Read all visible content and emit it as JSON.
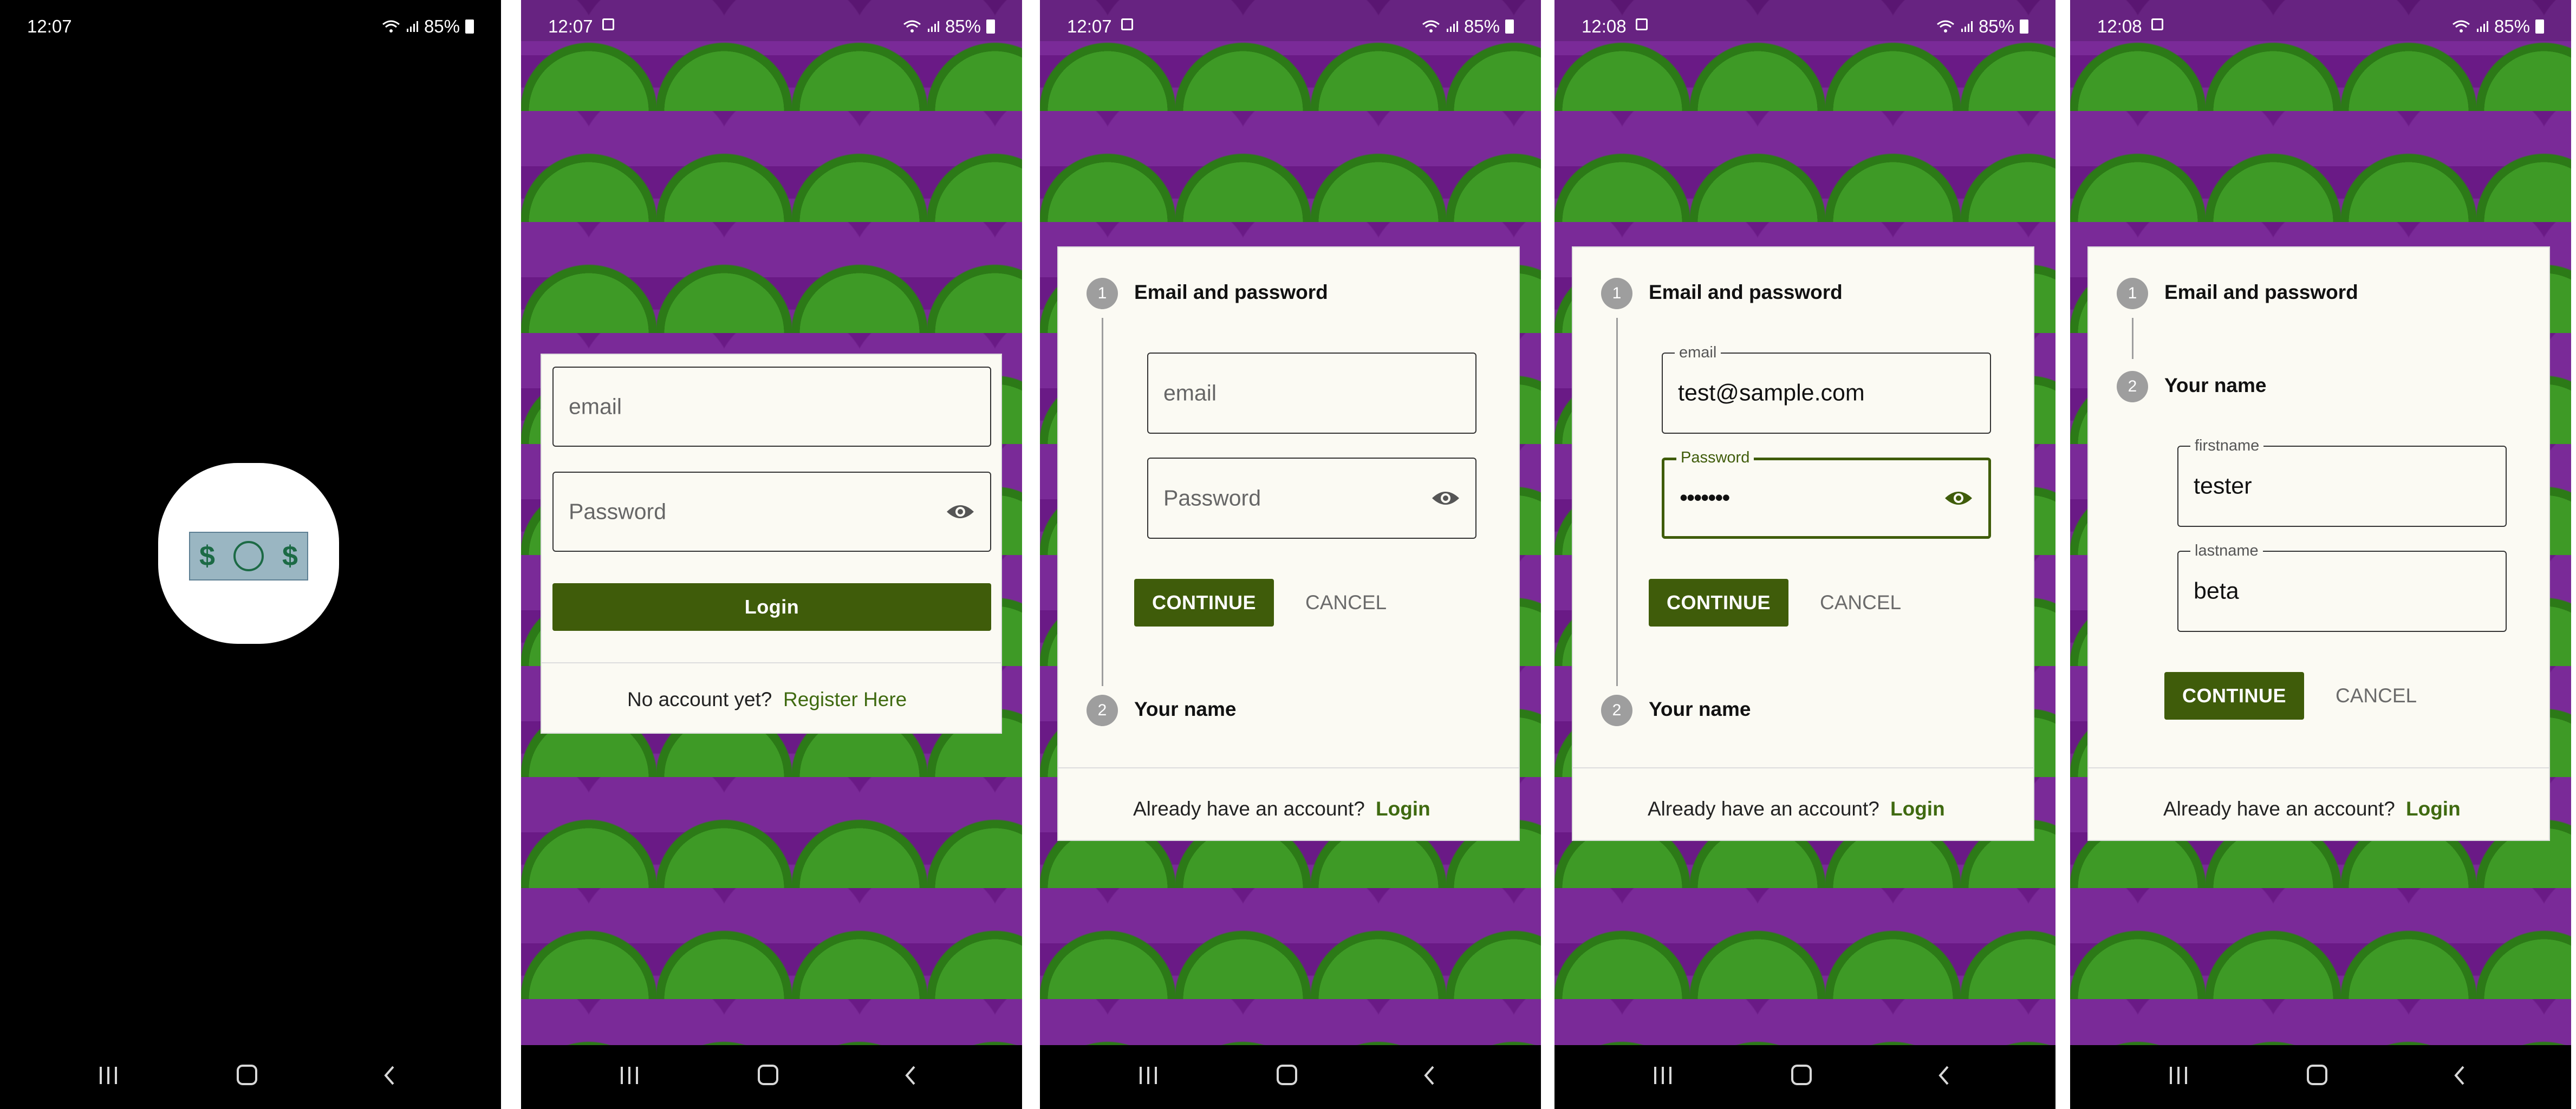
{
  "status": {
    "times": [
      "12:07",
      "12:07",
      "12:07",
      "12:08",
      "12:08"
    ],
    "battery": "85%"
  },
  "login": {
    "email_placeholder": "email",
    "password_placeholder": "Password",
    "login_button": "Login",
    "no_account": "No account yet?",
    "register_link": "Register Here"
  },
  "register": {
    "step1_number": "1",
    "step1_title": "Email and password",
    "step2_number": "2",
    "step2_title": "Your name",
    "email_placeholder": "email",
    "password_placeholder": "Password",
    "email_label": "email",
    "email_value": "test@sample.com",
    "password_label": "Password",
    "password_value": "•••••••",
    "firstname_label": "firstname",
    "firstname_value": "tester",
    "lastname_label": "lastname",
    "lastname_value": "beta",
    "continue": "CONTINUE",
    "cancel": "CANCEL",
    "have_account": "Already have an account?",
    "login_link": "Login"
  },
  "colors": {
    "primary": "#3f5c0a",
    "wallpaper_purple": "#6a1a86",
    "wallpaper_green": "#3e9a26",
    "card_bg": "#fbfaf3"
  },
  "icons": [
    "wifi-icon",
    "signal-icon",
    "battery-icon",
    "image-notification-icon",
    "eye-icon",
    "recent-apps-icon",
    "home-icon",
    "back-icon",
    "app-money-icon"
  ]
}
